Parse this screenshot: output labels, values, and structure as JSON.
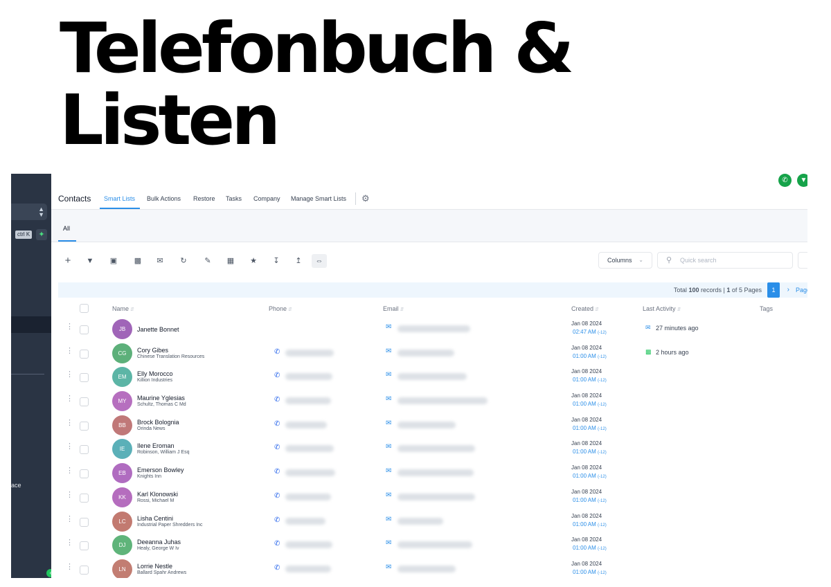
{
  "headline": {
    "line1": "Telefonbuch &",
    "line2": "Listen"
  },
  "sidebar": {
    "ctrl_shortcut": "ctrl K",
    "partial_text": "ace"
  },
  "header": {
    "title": "Contacts",
    "nav": [
      "Smart Lists",
      "Bulk Actions",
      "Restore",
      "Tasks",
      "Company",
      "Manage Smart Lists"
    ]
  },
  "tabs": {
    "all": "All"
  },
  "toolbar": {
    "icons": [
      "plus-icon",
      "filter-icon",
      "bot-icon",
      "message-icon",
      "email-icon",
      "clipboard-sync-icon",
      "clipboard-icon",
      "trash-icon",
      "star-icon",
      "download-icon",
      "upload-icon",
      "merge-icon"
    ],
    "columns_label": "Columns",
    "search_placeholder": "Quick search"
  },
  "pagination": {
    "total_label": "Total",
    "total_records": "100",
    "records_label": "records |",
    "page_current": "1",
    "of_label": "of",
    "page_count": "5",
    "pages_label": "Pages",
    "active_page": "1",
    "page_link": "Page"
  },
  "table": {
    "headers": {
      "name": "Name",
      "phone": "Phone",
      "email": "Email",
      "created": "Created",
      "last_activity": "Last Activity",
      "tags": "Tags"
    },
    "rows": [
      {
        "initials": "JB",
        "name": "Janette Bonnet",
        "company": "",
        "avatar_color": "#a065b8",
        "has_phone": false,
        "date": "Jan 08 2024",
        "time": "02:47 AM",
        "tz": "(-12)",
        "activity": "27 minutes ago",
        "activity_icon": "email-icon"
      },
      {
        "initials": "CG",
        "name": "Cory Gibes",
        "company": "Chinese Translation Resources",
        "avatar_color": "#5db07a",
        "has_phone": true,
        "date": "Jan 08 2024",
        "time": "01:00 AM",
        "tz": "(-12)",
        "activity": "2 hours ago",
        "activity_icon": "sms-icon"
      },
      {
        "initials": "EM",
        "name": "Elly Morocco",
        "company": "Killion Industries",
        "avatar_color": "#5cb5a6",
        "has_phone": true,
        "date": "Jan 08 2024",
        "time": "01:00 AM",
        "tz": "(-12)",
        "activity": "",
        "activity_icon": ""
      },
      {
        "initials": "MY",
        "name": "Maurine Yglesias",
        "company": "Schultz, Thomas C Md",
        "avatar_color": "#b66fbf",
        "has_phone": true,
        "date": "Jan 08 2024",
        "time": "01:00 AM",
        "tz": "(-12)",
        "activity": "",
        "activity_icon": ""
      },
      {
        "initials": "BB",
        "name": "Brock Bolognia",
        "company": "Orinda News",
        "avatar_color": "#c07878",
        "has_phone": true,
        "date": "Jan 08 2024",
        "time": "01:00 AM",
        "tz": "(-12)",
        "activity": "",
        "activity_icon": ""
      },
      {
        "initials": "IE",
        "name": "Ilene Eroman",
        "company": "Robinson, William J Esq",
        "avatar_color": "#5bb0b8",
        "has_phone": true,
        "date": "Jan 08 2024",
        "time": "01:00 AM",
        "tz": "(-12)",
        "activity": "",
        "activity_icon": ""
      },
      {
        "initials": "EB",
        "name": "Emerson Bowley",
        "company": "Knights Inn",
        "avatar_color": "#b06cc0",
        "has_phone": true,
        "date": "Jan 08 2024",
        "time": "01:00 AM",
        "tz": "(-12)",
        "activity": "",
        "activity_icon": ""
      },
      {
        "initials": "KK",
        "name": "Karl Klonowski",
        "company": "Rossi, Michael M",
        "avatar_color": "#b56dbe",
        "has_phone": true,
        "date": "Jan 08 2024",
        "time": "01:00 AM",
        "tz": "(-12)",
        "activity": "",
        "activity_icon": ""
      },
      {
        "initials": "LC",
        "name": "Lisha Centini",
        "company": "Industrial Paper Shredders Inc",
        "avatar_color": "#c27a70",
        "has_phone": true,
        "date": "Jan 08 2024",
        "time": "01:00 AM",
        "tz": "(-12)",
        "activity": "",
        "activity_icon": ""
      },
      {
        "initials": "DJ",
        "name": "Deeanna Juhas",
        "company": "Healy, George W Iv",
        "avatar_color": "#5fb47a",
        "has_phone": true,
        "date": "Jan 08 2024",
        "time": "01:00 AM",
        "tz": "(-12)",
        "activity": "",
        "activity_icon": ""
      },
      {
        "initials": "LN",
        "name": "Lorrie Nestle",
        "company": "Ballard Spahr Andrews",
        "avatar_color": "#c27d72",
        "has_phone": true,
        "date": "Jan 08 2024",
        "time": "01:00 AM",
        "tz": "(-12)",
        "activity": "",
        "activity_icon": ""
      }
    ]
  },
  "colors": {
    "accent": "#2a8ee8",
    "sidebar": "#2a3444",
    "activity_email": "#2a8ee8",
    "activity_sms": "#22c55e"
  }
}
